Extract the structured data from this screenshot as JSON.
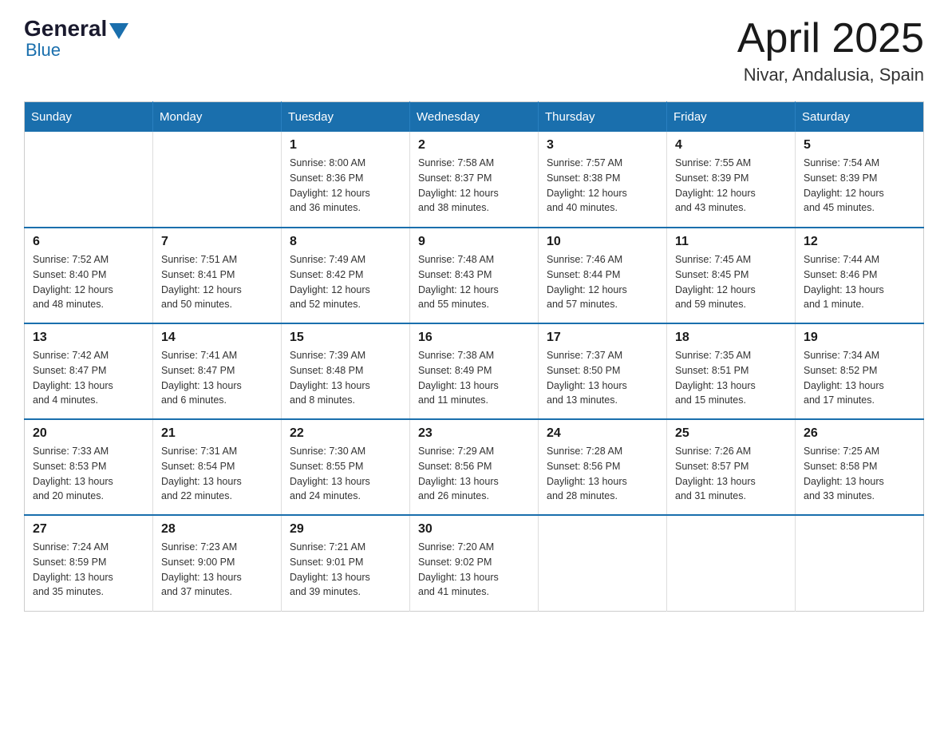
{
  "header": {
    "logo_general": "General",
    "logo_blue": "Blue",
    "month_title": "April 2025",
    "location": "Nivar, Andalusia, Spain"
  },
  "calendar": {
    "days_of_week": [
      "Sunday",
      "Monday",
      "Tuesday",
      "Wednesday",
      "Thursday",
      "Friday",
      "Saturday"
    ],
    "weeks": [
      [
        {
          "day": "",
          "info": ""
        },
        {
          "day": "",
          "info": ""
        },
        {
          "day": "1",
          "info": "Sunrise: 8:00 AM\nSunset: 8:36 PM\nDaylight: 12 hours\nand 36 minutes."
        },
        {
          "day": "2",
          "info": "Sunrise: 7:58 AM\nSunset: 8:37 PM\nDaylight: 12 hours\nand 38 minutes."
        },
        {
          "day": "3",
          "info": "Sunrise: 7:57 AM\nSunset: 8:38 PM\nDaylight: 12 hours\nand 40 minutes."
        },
        {
          "day": "4",
          "info": "Sunrise: 7:55 AM\nSunset: 8:39 PM\nDaylight: 12 hours\nand 43 minutes."
        },
        {
          "day": "5",
          "info": "Sunrise: 7:54 AM\nSunset: 8:39 PM\nDaylight: 12 hours\nand 45 minutes."
        }
      ],
      [
        {
          "day": "6",
          "info": "Sunrise: 7:52 AM\nSunset: 8:40 PM\nDaylight: 12 hours\nand 48 minutes."
        },
        {
          "day": "7",
          "info": "Sunrise: 7:51 AM\nSunset: 8:41 PM\nDaylight: 12 hours\nand 50 minutes."
        },
        {
          "day": "8",
          "info": "Sunrise: 7:49 AM\nSunset: 8:42 PM\nDaylight: 12 hours\nand 52 minutes."
        },
        {
          "day": "9",
          "info": "Sunrise: 7:48 AM\nSunset: 8:43 PM\nDaylight: 12 hours\nand 55 minutes."
        },
        {
          "day": "10",
          "info": "Sunrise: 7:46 AM\nSunset: 8:44 PM\nDaylight: 12 hours\nand 57 minutes."
        },
        {
          "day": "11",
          "info": "Sunrise: 7:45 AM\nSunset: 8:45 PM\nDaylight: 12 hours\nand 59 minutes."
        },
        {
          "day": "12",
          "info": "Sunrise: 7:44 AM\nSunset: 8:46 PM\nDaylight: 13 hours\nand 1 minute."
        }
      ],
      [
        {
          "day": "13",
          "info": "Sunrise: 7:42 AM\nSunset: 8:47 PM\nDaylight: 13 hours\nand 4 minutes."
        },
        {
          "day": "14",
          "info": "Sunrise: 7:41 AM\nSunset: 8:47 PM\nDaylight: 13 hours\nand 6 minutes."
        },
        {
          "day": "15",
          "info": "Sunrise: 7:39 AM\nSunset: 8:48 PM\nDaylight: 13 hours\nand 8 minutes."
        },
        {
          "day": "16",
          "info": "Sunrise: 7:38 AM\nSunset: 8:49 PM\nDaylight: 13 hours\nand 11 minutes."
        },
        {
          "day": "17",
          "info": "Sunrise: 7:37 AM\nSunset: 8:50 PM\nDaylight: 13 hours\nand 13 minutes."
        },
        {
          "day": "18",
          "info": "Sunrise: 7:35 AM\nSunset: 8:51 PM\nDaylight: 13 hours\nand 15 minutes."
        },
        {
          "day": "19",
          "info": "Sunrise: 7:34 AM\nSunset: 8:52 PM\nDaylight: 13 hours\nand 17 minutes."
        }
      ],
      [
        {
          "day": "20",
          "info": "Sunrise: 7:33 AM\nSunset: 8:53 PM\nDaylight: 13 hours\nand 20 minutes."
        },
        {
          "day": "21",
          "info": "Sunrise: 7:31 AM\nSunset: 8:54 PM\nDaylight: 13 hours\nand 22 minutes."
        },
        {
          "day": "22",
          "info": "Sunrise: 7:30 AM\nSunset: 8:55 PM\nDaylight: 13 hours\nand 24 minutes."
        },
        {
          "day": "23",
          "info": "Sunrise: 7:29 AM\nSunset: 8:56 PM\nDaylight: 13 hours\nand 26 minutes."
        },
        {
          "day": "24",
          "info": "Sunrise: 7:28 AM\nSunset: 8:56 PM\nDaylight: 13 hours\nand 28 minutes."
        },
        {
          "day": "25",
          "info": "Sunrise: 7:26 AM\nSunset: 8:57 PM\nDaylight: 13 hours\nand 31 minutes."
        },
        {
          "day": "26",
          "info": "Sunrise: 7:25 AM\nSunset: 8:58 PM\nDaylight: 13 hours\nand 33 minutes."
        }
      ],
      [
        {
          "day": "27",
          "info": "Sunrise: 7:24 AM\nSunset: 8:59 PM\nDaylight: 13 hours\nand 35 minutes."
        },
        {
          "day": "28",
          "info": "Sunrise: 7:23 AM\nSunset: 9:00 PM\nDaylight: 13 hours\nand 37 minutes."
        },
        {
          "day": "29",
          "info": "Sunrise: 7:21 AM\nSunset: 9:01 PM\nDaylight: 13 hours\nand 39 minutes."
        },
        {
          "day": "30",
          "info": "Sunrise: 7:20 AM\nSunset: 9:02 PM\nDaylight: 13 hours\nand 41 minutes."
        },
        {
          "day": "",
          "info": ""
        },
        {
          "day": "",
          "info": ""
        },
        {
          "day": "",
          "info": ""
        }
      ]
    ]
  }
}
